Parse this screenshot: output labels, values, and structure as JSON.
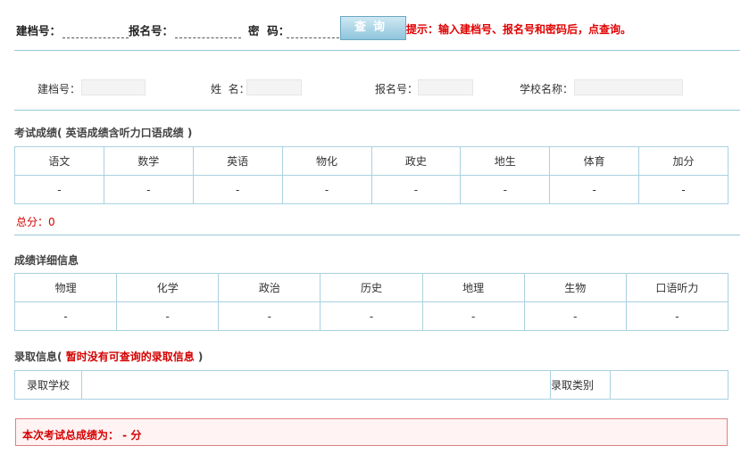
{
  "search": {
    "archive_label": "建档号：",
    "register_label": "报名号：",
    "password_label": "密  码：",
    "archive_value": "",
    "register_value": "",
    "password_value": "",
    "query_button": "查询",
    "hint": "提示：输入建档号、报名号和密码后，点查询。"
  },
  "info": {
    "archive_label": "建档号：",
    "name_label": "姓  名：",
    "register_label": "报名号：",
    "school_label": "学校名称：",
    "archive_value": "",
    "name_value": "",
    "register_value": "",
    "school_value": ""
  },
  "scores": {
    "title": "考试成绩",
    "note": "( 英语成绩含听力口语成绩 )",
    "headers": [
      "语文",
      "数学",
      "英语",
      "物化",
      "政史",
      "地生",
      "体育",
      "加分"
    ],
    "values": [
      "-",
      "-",
      "-",
      "-",
      "-",
      "-",
      "-",
      "-"
    ],
    "total": "总分：0"
  },
  "details": {
    "title": "成绩详细信息",
    "headers": [
      "物理",
      "化学",
      "政治",
      "历史",
      "地理",
      "生物",
      "口语听力"
    ],
    "values": [
      "-",
      "-",
      "-",
      "-",
      "-",
      "-",
      "-"
    ]
  },
  "admission": {
    "title": "录取信息",
    "paren_open": "( ",
    "notice": "暂时没有可查询的录取信息",
    "paren_close": " )",
    "school_label": "录取学校",
    "school_value": "",
    "category_label": "录取类别",
    "category_value": ""
  },
  "final": {
    "text": "本次考试总成绩为： - 分"
  },
  "colors": {
    "accent_red": "#d40000",
    "border_blue": "#a9d1e0",
    "button_blue": "#8fc5dc"
  }
}
